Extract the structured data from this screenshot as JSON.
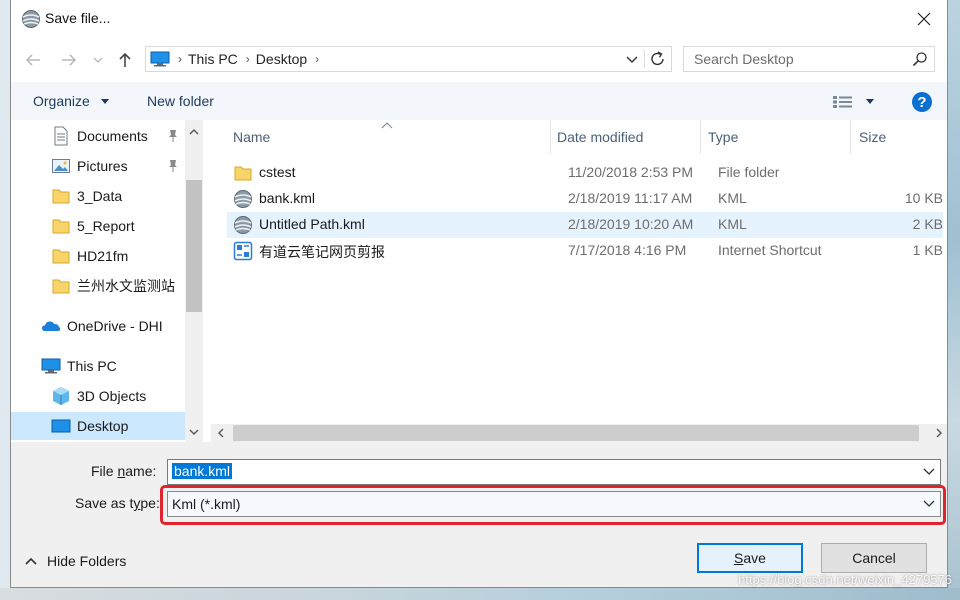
{
  "window": {
    "title": "Save file..."
  },
  "address": {
    "crumbs": [
      "This PC",
      "Desktop"
    ]
  },
  "search": {
    "placeholder": "Search Desktop"
  },
  "toolbar": {
    "organize": "Organize",
    "new_folder": "New folder"
  },
  "sidebar": {
    "items": [
      {
        "label": "Documents",
        "icon": "documents-icon",
        "pinned": true
      },
      {
        "label": "Pictures",
        "icon": "pictures-icon",
        "pinned": true
      },
      {
        "label": "3_Data",
        "icon": "folder-icon"
      },
      {
        "label": "5_Report",
        "icon": "folder-icon"
      },
      {
        "label": "HD21fm",
        "icon": "folder-icon"
      },
      {
        "label": "兰州水文监测站",
        "icon": "folder-icon"
      },
      {
        "label": "OneDrive - DHI",
        "icon": "onedrive-icon"
      },
      {
        "label": "This PC",
        "icon": "pc-icon"
      },
      {
        "label": "3D Objects",
        "icon": "3d-objects-icon"
      },
      {
        "label": "Desktop",
        "icon": "desktop-icon",
        "selected": true
      }
    ]
  },
  "files": {
    "columns": [
      "Name",
      "Date modified",
      "Type",
      "Size"
    ],
    "rows": [
      {
        "name": "cstest",
        "date": "11/20/2018 2:53 PM",
        "type": "File folder",
        "size": "",
        "icon": "folder-icon"
      },
      {
        "name": "bank.kml",
        "date": "2/18/2019 11:17 AM",
        "type": "KML",
        "size": "10 KB",
        "icon": "kml-icon"
      },
      {
        "name": "Untitled Path.kml",
        "date": "2/18/2019 10:20 AM",
        "type": "KML",
        "size": "2 KB",
        "icon": "kml-icon",
        "hover": true
      },
      {
        "name": "有道云笔记网页剪报",
        "date": "7/17/2018 4:16 PM",
        "type": "Internet Shortcut",
        "size": "1 KB",
        "icon": "shortcut-icon"
      }
    ]
  },
  "form": {
    "file_name_label_pre": "File ",
    "file_name_label_key": "n",
    "file_name_label_post": "ame:",
    "file_name_value": "bank.kml",
    "save_type_label_pre": "Save as t",
    "save_type_label_key": "y",
    "save_type_label_post": "pe:",
    "save_type_value": "Kml (*.kml)"
  },
  "footer": {
    "hide_folders": "Hide Folders",
    "save_key": "S",
    "save_rest": "ave",
    "cancel": "Cancel"
  },
  "watermark": "https://blog.csdn.net/weixin_4279576",
  "colors": {
    "accent": "#0078d7",
    "highlight": "#e1242b",
    "selected": "#cce8ff"
  }
}
